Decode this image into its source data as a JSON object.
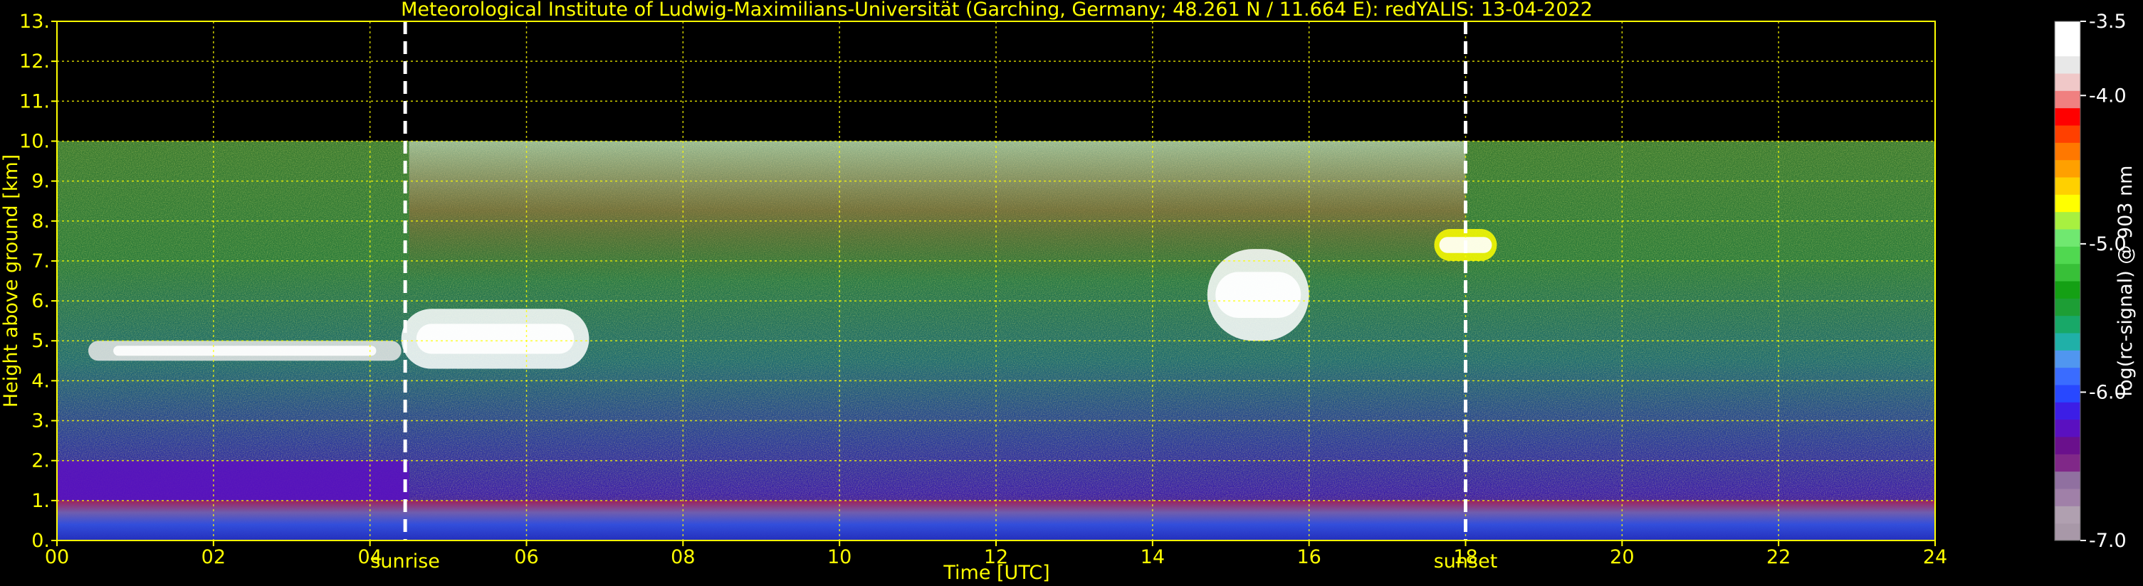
{
  "chart_data": {
    "type": "heatmap",
    "title": "Meteorological Institute of Ludwig-Maximilians-Universität (Garching, Germany; 48.261 N / 11.664 E):    redYALIS: 13-04-2022",
    "xlabel": "Time [UTC]",
    "ylabel": "Height above ground [km]",
    "xlim": [
      0,
      24
    ],
    "ylim": [
      0,
      13
    ],
    "x_ticks": [
      {
        "value": 0,
        "label": "00"
      },
      {
        "value": 2,
        "label": "02"
      },
      {
        "value": 4,
        "label": "04"
      },
      {
        "value": 6,
        "label": "06"
      },
      {
        "value": 8,
        "label": "08"
      },
      {
        "value": 10,
        "label": "10"
      },
      {
        "value": 12,
        "label": "12"
      },
      {
        "value": 14,
        "label": "14"
      },
      {
        "value": 16,
        "label": "16"
      },
      {
        "value": 18,
        "label": "18"
      },
      {
        "value": 20,
        "label": "20"
      },
      {
        "value": 22,
        "label": "22"
      },
      {
        "value": 24,
        "label": "24"
      }
    ],
    "y_ticks": [
      {
        "value": 0,
        "label": "0."
      },
      {
        "value": 1,
        "label": "1."
      },
      {
        "value": 2,
        "label": "2."
      },
      {
        "value": 3,
        "label": "3."
      },
      {
        "value": 4,
        "label": "4."
      },
      {
        "value": 5,
        "label": "5."
      },
      {
        "value": 6,
        "label": "6."
      },
      {
        "value": 7,
        "label": "7."
      },
      {
        "value": 8,
        "label": "8."
      },
      {
        "value": 9,
        "label": "9."
      },
      {
        "value": 10,
        "label": "10."
      },
      {
        "value": 11,
        "label": "11."
      },
      {
        "value": 12,
        "label": "12."
      },
      {
        "value": 13,
        "label": "13."
      }
    ],
    "grid": true,
    "data_top_km": 10,
    "markers": [
      {
        "name": "sunrise",
        "label": "sunrise",
        "x": 4.45
      },
      {
        "name": "sunset",
        "label": "sunset",
        "x": 18.0
      }
    ],
    "colorbar": {
      "label": "log(rc-signal) @ 903 nm",
      "range": [
        -7.0,
        -3.5
      ],
      "ticks": [
        {
          "value": -3.5,
          "label": "-3.5"
        },
        {
          "value": -4.0,
          "label": "-4.0"
        },
        {
          "value": -5.0,
          "label": "-5.0"
        },
        {
          "value": -6.0,
          "label": "-6.0"
        },
        {
          "value": -7.0,
          "label": "-7.0"
        }
      ],
      "colors": [
        "#a898a8",
        "#b0a0b0",
        "#a080a8",
        "#9070a0",
        "#802888",
        "#6a108c",
        "#5a10c0",
        "#3c1ee6",
        "#2848ff",
        "#3a6cff",
        "#5096f0",
        "#20b0a8",
        "#18a868",
        "#1d9e35",
        "#14a014",
        "#38c038",
        "#50d850",
        "#70e870",
        "#a8f040",
        "#ffff00",
        "#ffd000",
        "#ffa000",
        "#ff7800",
        "#ff4000",
        "#ff0000",
        "#f08080",
        "#f0c8c8",
        "#e8e8e8",
        "#ffffff",
        "#ffffff"
      ]
    },
    "layers": [
      {
        "name": "boundary-layer",
        "t0": 0,
        "t1": 24,
        "z0": 0,
        "z1": 1.0,
        "level": -6.7
      },
      {
        "name": "residual-layer",
        "t0": 0,
        "t1": 4.5,
        "z0": 1.0,
        "z1": 2.0,
        "level": -6.2
      },
      {
        "name": "midlevel-cloud-morning",
        "t0": 0.4,
        "t1": 4.4,
        "z0": 4.5,
        "z1": 5.0,
        "level": -3.8
      },
      {
        "name": "midlevel-cloud-sunrise",
        "t0": 4.4,
        "t1": 6.8,
        "z0": 4.3,
        "z1": 5.8,
        "level": -3.6
      },
      {
        "name": "cirrus-noon",
        "t0": 4.5,
        "t1": 18.0,
        "z0": 6.5,
        "z1": 10.0,
        "level": -4.5
      },
      {
        "name": "cloud-afternoon",
        "t0": 14.7,
        "t1": 16.0,
        "z0": 5.0,
        "z1": 7.3,
        "level": -3.7
      },
      {
        "name": "cloud-evening",
        "t0": 17.6,
        "t1": 18.4,
        "z0": 7.0,
        "z1": 7.8,
        "level": -4.7
      }
    ]
  }
}
